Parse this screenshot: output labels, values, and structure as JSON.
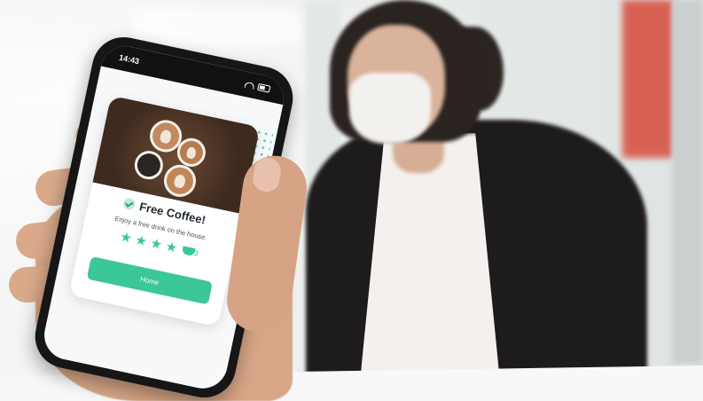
{
  "phone": {
    "status_time": "14:43",
    "card": {
      "title": "Free Coffee!",
      "subtitle": "Enjoy a free drink on the house.",
      "rating": 4,
      "rating_max": 4,
      "button_label": "Home"
    }
  },
  "colors": {
    "accent": "#3cc796",
    "star": "#38c79a",
    "dots": "#5cc7b3",
    "coat": "#1d1b1c",
    "red_panel": "#d84a3c"
  },
  "icons": [
    "check-badge-icon",
    "star-icon",
    "coffee-cup-icon",
    "wifi-icon",
    "battery-icon"
  ]
}
